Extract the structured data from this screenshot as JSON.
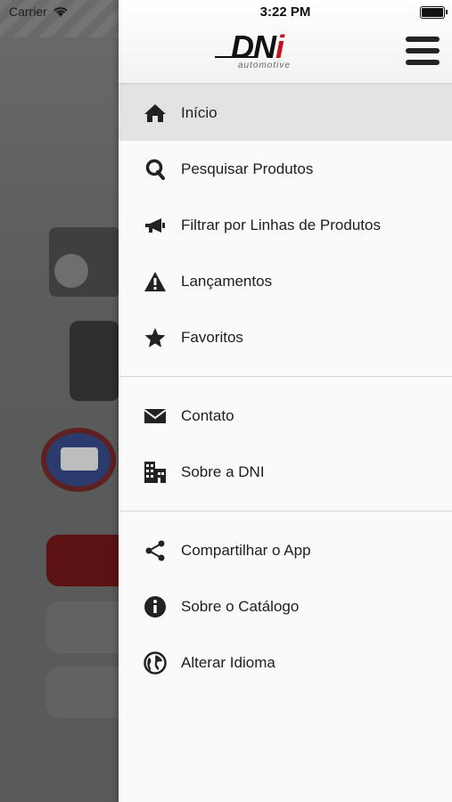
{
  "status_bar": {
    "carrier": "Carrier",
    "time": "3:22 PM"
  },
  "logo": {
    "brand_main": "DN",
    "brand_accent": "i",
    "tagline": "automotive"
  },
  "menu": {
    "group1": [
      {
        "label": "Início",
        "icon": "home-icon",
        "active": true
      },
      {
        "label": "Pesquisar Produtos",
        "icon": "search-icon"
      },
      {
        "label": "Filtrar por Linhas de Produtos",
        "icon": "megaphone-icon"
      },
      {
        "label": "Lançamentos",
        "icon": "warning-icon"
      },
      {
        "label": "Favoritos",
        "icon": "star-icon"
      }
    ],
    "group2": [
      {
        "label": "Contato",
        "icon": "envelope-icon"
      },
      {
        "label": "Sobre a DNI",
        "icon": "building-icon"
      }
    ],
    "group3": [
      {
        "label": "Compartilhar o App",
        "icon": "share-icon"
      },
      {
        "label": "Sobre o Catálogo",
        "icon": "info-icon"
      },
      {
        "label": "Alterar Idioma",
        "icon": "globe-icon"
      }
    ]
  },
  "colors": {
    "accent": "#c1121f",
    "active_bg": "#e3e3e3",
    "overlay": "#5a5a5a"
  }
}
